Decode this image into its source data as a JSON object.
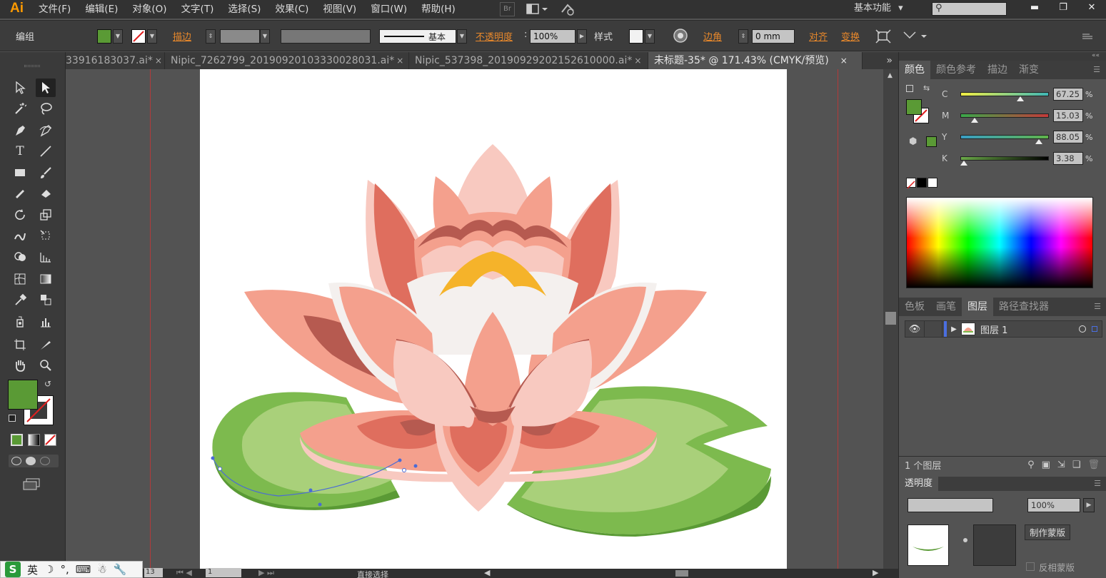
{
  "app": {
    "logo": "Ai"
  },
  "menubar": {
    "items": [
      "文件(F)",
      "编辑(E)",
      "对象(O)",
      "文字(T)",
      "选择(S)",
      "效果(C)",
      "视图(V)",
      "窗口(W)",
      "帮助(H)"
    ],
    "bridge_label": "Br",
    "workspace": "基本功能",
    "workspace_arrow": "▾"
  },
  "window_buttons": {
    "min": "▬",
    "max": "❐",
    "close": "✕"
  },
  "controlbar": {
    "selection": "编组",
    "stroke_label": "描边",
    "stroke_style": "基本",
    "opacity_label": "不透明度",
    "opacity_value": "100%",
    "style_label": "样式",
    "corner_label": "边角",
    "corner_value": "0 mm",
    "align_label": "对齐",
    "transform_label": "变换",
    "fill_color": "#5a9a35"
  },
  "tabs": [
    {
      "label": "33916183037.ai*",
      "close": "×"
    },
    {
      "label": "Nipic_7262799_20190920103330028031.ai*",
      "close": "×"
    },
    {
      "label": "Nipic_537398_20190929202152610000.ai*",
      "close": "×"
    },
    {
      "label": "未标题-35* @ 171.43% (CMYK/预览)",
      "close": "×"
    }
  ],
  "tabs_overflow": "»",
  "toolbar": {
    "tools": [
      "selection-tool",
      "direct-selection-tool",
      "magic-wand-tool",
      "lasso-tool",
      "pen-tool",
      "curvature-tool",
      "type-tool",
      "line-tool",
      "rectangle-tool",
      "paintbrush-tool",
      "pencil-tool",
      "eraser-tool",
      "rotate-tool",
      "scale-tool",
      "warp-tool",
      "free-transform-tool",
      "shape-builder-tool",
      "perspective-grid-tool",
      "mesh-tool",
      "gradient-tool",
      "eyedropper-tool",
      "blend-tool",
      "symbol-sprayer-tool",
      "column-graph-tool",
      "artboard-tool",
      "slice-tool",
      "hand-tool",
      "zoom-tool"
    ],
    "text_tool_glyph": "T",
    "fill_color": "#5a9a35"
  },
  "color_panel": {
    "tabs": [
      "颜色",
      "颜色参考",
      "描边",
      "渐变"
    ],
    "active_tab": "颜色",
    "channels": [
      {
        "name": "C",
        "value": "67.25",
        "level": 0.6725,
        "track": "linear-gradient(to right,#f2ee45,#3fb7b5)"
      },
      {
        "name": "M",
        "value": "15.03",
        "level": 0.1503,
        "track": "linear-gradient(to right,#3aa84a,#c43a3a)"
      },
      {
        "name": "Y",
        "value": "88.05",
        "level": 0.8805,
        "track": "linear-gradient(to right,#3a9ec4,#5fb44a)"
      },
      {
        "name": "K",
        "value": "3.38",
        "level": 0.0338,
        "track": "linear-gradient(to right,#6aa848,#000000)"
      }
    ],
    "unit": "%"
  },
  "layers_panel": {
    "tabs": [
      "色板",
      "画笔",
      "图层",
      "路径查找器"
    ],
    "active_tab": "图层",
    "layers": [
      {
        "name": "图层 1"
      }
    ],
    "count_label": "1 个图层"
  },
  "transparency_panel": {
    "title": "透明度",
    "opacity": "100%",
    "make_mask": "制作蒙版",
    "invert_mask": "反相蒙版"
  },
  "statusbar": {
    "zoom": "13",
    "page": "1",
    "tool": "直接选择"
  },
  "ime": {
    "logo": "S",
    "lang": "英"
  }
}
